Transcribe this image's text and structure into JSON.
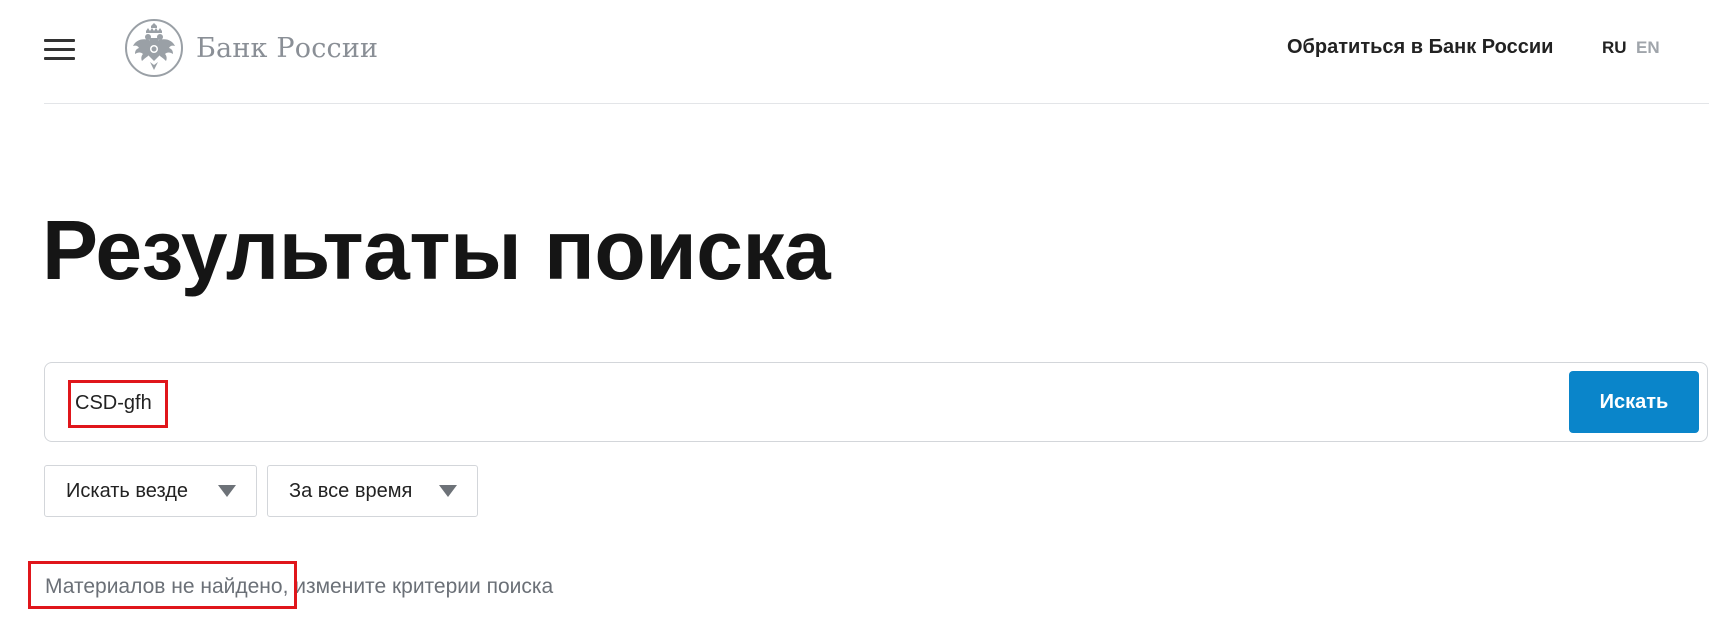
{
  "header": {
    "logo_text": "Банк России",
    "contact_link": "Обратиться в Банк России",
    "languages": [
      {
        "code": "RU",
        "active": true
      },
      {
        "code": "EN",
        "active": false
      }
    ]
  },
  "main": {
    "title": "Результаты поиска",
    "search": {
      "value": "CSD-gfh",
      "button_label": "Искать"
    },
    "filters": {
      "scope": "Искать везде",
      "period": "За все время"
    },
    "result_message": "Материалов не найдено, измените критерии поиска"
  },
  "colors": {
    "accent_button": "#0a85ca",
    "annotation_red": "#e0161b",
    "muted_text": "#6b7077"
  },
  "icons": [
    "menu-icon",
    "bank-emblem-icon",
    "chevron-down-icon"
  ]
}
